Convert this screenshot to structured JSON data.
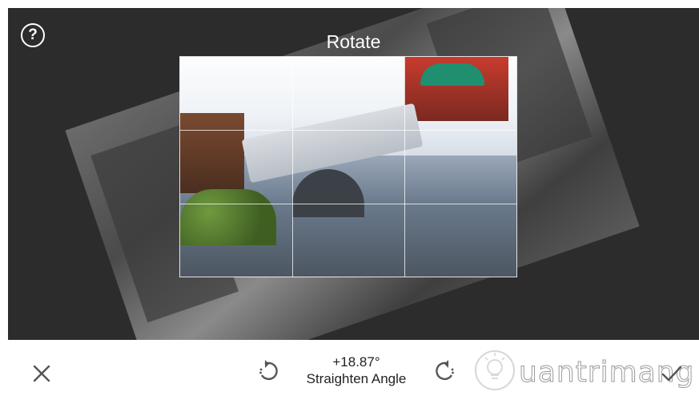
{
  "header": {
    "title": "Rotate",
    "help_icon": "help-circle-icon"
  },
  "rotation": {
    "angle": "+18.87°",
    "label": "Straighten Angle"
  },
  "toolbar": {
    "cancel_icon": "close-icon",
    "rotate_left_icon": "rotate-left-icon",
    "rotate_right_icon": "rotate-right-icon",
    "confirm_icon": "check-icon"
  },
  "watermark": {
    "text": "uantrimang",
    "icon": "lightbulb-logo-icon"
  },
  "colors": {
    "editor_background": "#2c2c2c",
    "toolbar_background": "#ffffff",
    "icon_color": "#555555"
  }
}
